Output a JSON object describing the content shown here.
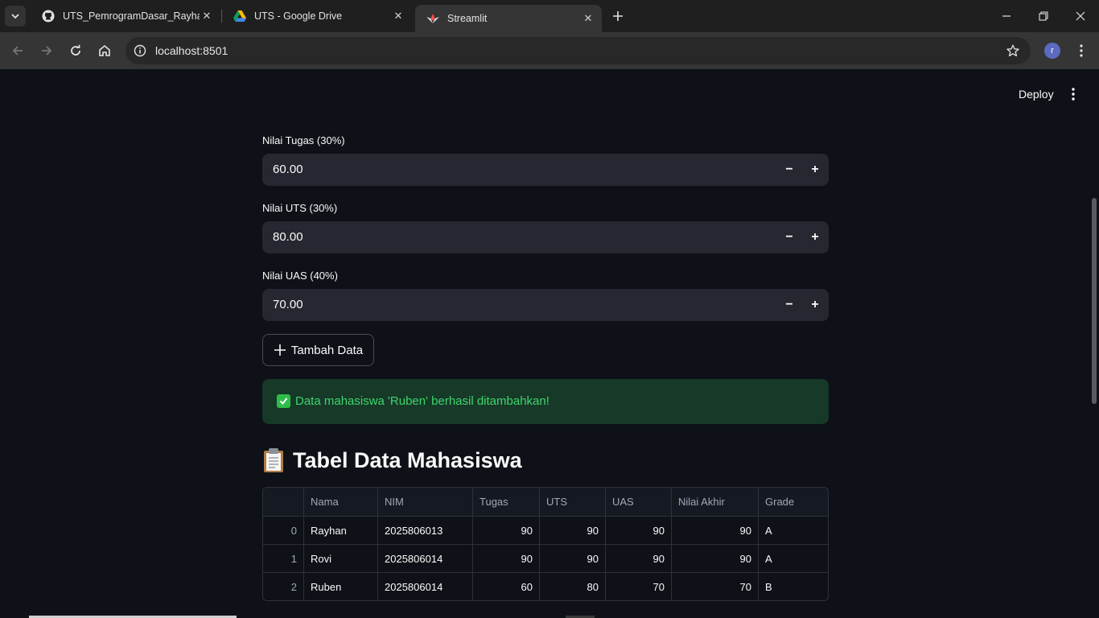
{
  "browser": {
    "tabs": [
      {
        "title": "UTS_PemrogramDasar_Rayhan-",
        "icon": "github-icon"
      },
      {
        "title": "UTS - Google Drive",
        "icon": "google-drive-icon"
      },
      {
        "title": "Streamlit",
        "icon": "streamlit-icon",
        "active": true
      }
    ],
    "url": "localhost:8501",
    "profile_initial": "r"
  },
  "app": {
    "deploy_label": "Deploy",
    "inputs": [
      {
        "label": "Nilai Tugas (30%)",
        "value": "60.00"
      },
      {
        "label": "Nilai UTS (30%)",
        "value": "80.00"
      },
      {
        "label": "Nilai UAS (40%)",
        "value": "70.00"
      }
    ],
    "add_button_label": "Tambah Data",
    "success_message": "Data mahasiswa 'Ruben' berhasil ditambahkan!",
    "table_heading": "Tabel Data Mahasiswa",
    "table": {
      "columns": [
        "",
        "Nama",
        "NIM",
        "Tugas",
        "UTS",
        "UAS",
        "Nilai Akhir",
        "Grade"
      ],
      "rows": [
        [
          "0",
          "Rayhan",
          "2025806013",
          "90",
          "90",
          "90",
          "90",
          "A"
        ],
        [
          "1",
          "Rovi",
          "2025806014",
          "90",
          "90",
          "90",
          "90",
          "A"
        ],
        [
          "2",
          "Ruben",
          "2025806014",
          "60",
          "80",
          "70",
          "70",
          "B"
        ]
      ]
    },
    "colors": {
      "background": "#0e1117",
      "input_bg": "#262730",
      "success_bg": "#173928",
      "success_text": "#3dd56d"
    }
  }
}
